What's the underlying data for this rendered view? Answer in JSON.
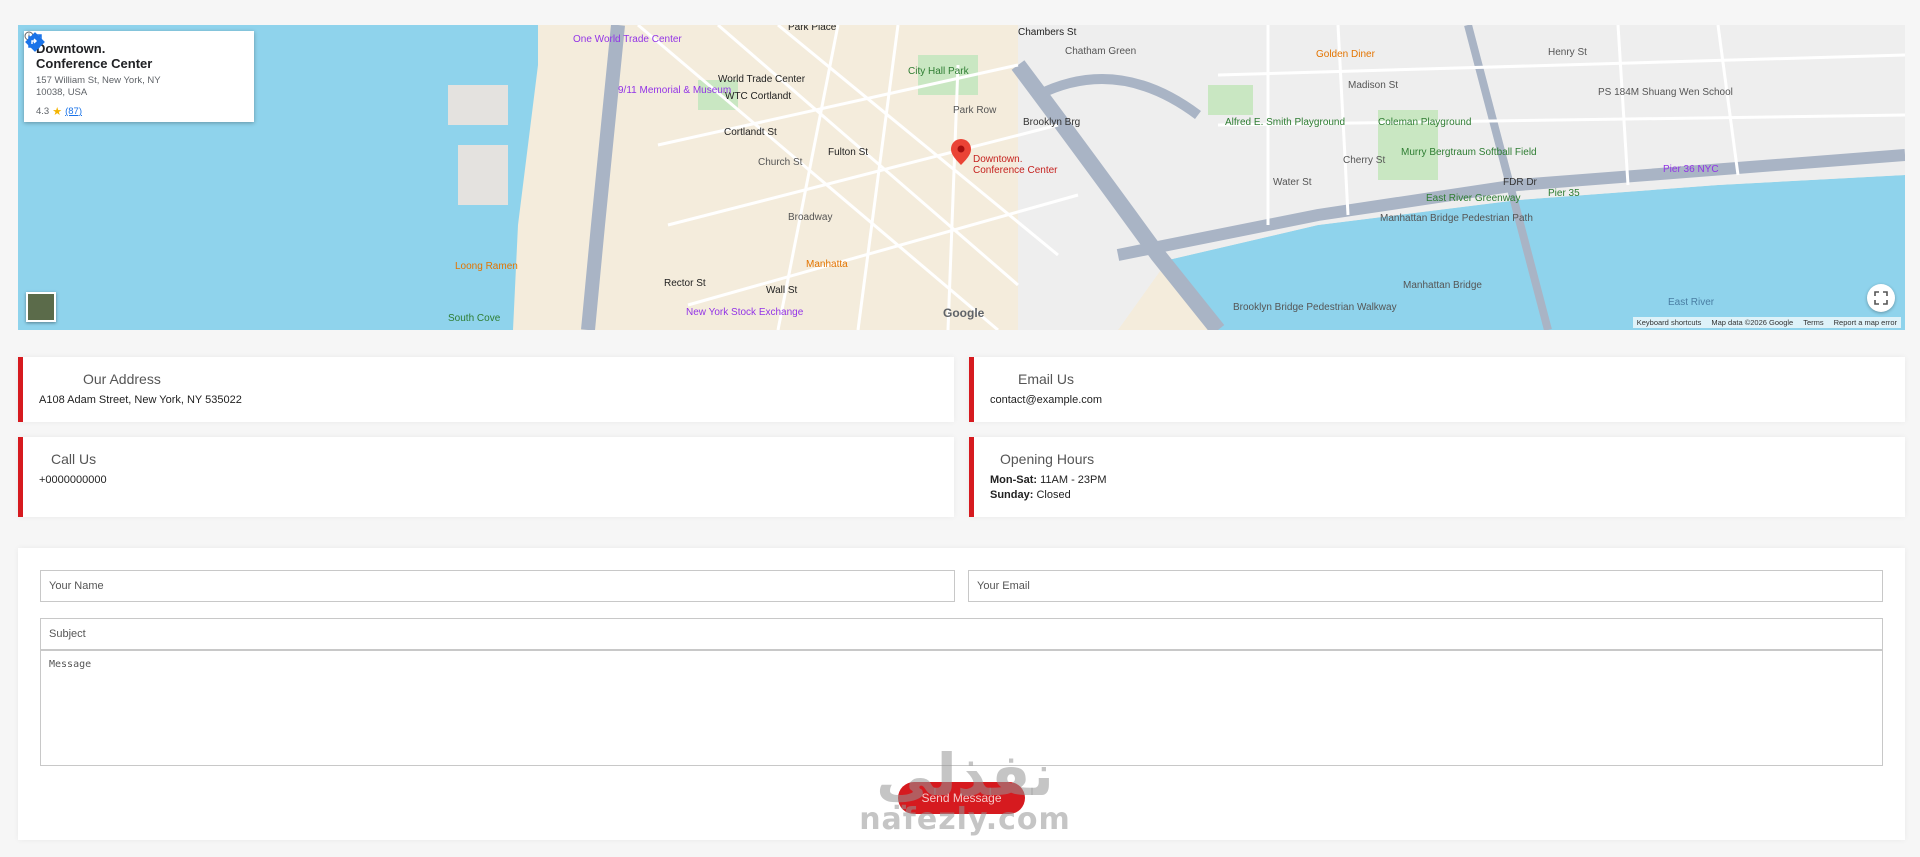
{
  "map": {
    "place_name": "Downtown. Conference Center",
    "place_address": "157 William St, New York, NY 10038, USA",
    "rating": "4.3",
    "rating_count": "(87)",
    "pin_label_line1": "Downtown.",
    "pin_label_line2": "Conference Center",
    "footer": [
      "Keyboard shortcuts",
      "Map data ©2026 Google",
      "Terms",
      "Report a map error"
    ],
    "google": "Google",
    "labels": [
      {
        "text": "One World Trade Center",
        "color": "#9334e6"
      },
      {
        "text": "World Trade Center",
        "color": "#222"
      },
      {
        "text": "WTC Cortlandt",
        "color": "#222"
      },
      {
        "text": "9/11 Memorial & Museum",
        "color": "#9334e6"
      },
      {
        "text": "Cortlandt St",
        "color": "#222"
      },
      {
        "text": "Fulton St",
        "color": "#222"
      },
      {
        "text": "Park Place",
        "color": "#222"
      },
      {
        "text": "Chambers St",
        "color": "#222"
      },
      {
        "text": "City Hall Park",
        "color": "#2e7d32"
      },
      {
        "text": "Chatham Green",
        "color": "#555"
      },
      {
        "text": "Golden Diner",
        "color": "#e37400"
      },
      {
        "text": "Alfred E. Smith Playground",
        "color": "#2e7d32"
      },
      {
        "text": "Coleman Playground",
        "color": "#2e7d32"
      },
      {
        "text": "Murry Bergtraum Softball Field",
        "color": "#2e7d32"
      },
      {
        "text": "PS 184M Shuang Wen School",
        "color": "#555"
      },
      {
        "text": "Pier 36 NYC",
        "color": "#9334e6"
      },
      {
        "text": "East River Greenway",
        "color": "#2e7d32"
      },
      {
        "text": "Pier 35",
        "color": "#2e7d32"
      },
      {
        "text": "Manhattan Bridge Pedestrian Path",
        "color": "#555"
      },
      {
        "text": "Manhattan Bridge",
        "color": "#555"
      },
      {
        "text": "Brooklyn Bridge Pedestrian Walkway",
        "color": "#555"
      },
      {
        "text": "East River",
        "color": "#4a7ea3"
      },
      {
        "text": "Loong Ramen",
        "color": "#e37400"
      },
      {
        "text": "Manhatta",
        "color": "#e37400"
      },
      {
        "text": "South Cove",
        "color": "#2e7d32"
      },
      {
        "text": "Rector St",
        "color": "#222"
      },
      {
        "text": "Wall St",
        "color": "#222"
      },
      {
        "text": "New York Stock Exchange",
        "color": "#9334e6"
      },
      {
        "text": "FDR Dr",
        "color": "#333"
      },
      {
        "text": "Brooklyn Brg",
        "color": "#333"
      },
      {
        "text": "Water St",
        "color": "#555"
      },
      {
        "text": "Cherry St",
        "color": "#555"
      },
      {
        "text": "Madison St",
        "color": "#555"
      },
      {
        "text": "Henry St",
        "color": "#555"
      },
      {
        "text": "Park Row",
        "color": "#555"
      },
      {
        "text": "Broadway",
        "color": "#555"
      },
      {
        "text": "Church St",
        "color": "#555"
      }
    ]
  },
  "contacts": {
    "address_title": "Our Address",
    "address_value": "A108 Adam Street, New York, NY 535022",
    "email_title": "Email Us",
    "email_value": "contact@example.com",
    "call_title": "Call Us",
    "call_value": "+0000000000",
    "hours_title": "Opening Hours",
    "hours_weekday_label": "Mon-Sat:",
    "hours_weekday_value": "11AM - 23PM",
    "hours_sunday_label": "Sunday:",
    "hours_sunday_value": "Closed"
  },
  "form": {
    "name_placeholder": "Your Name",
    "email_placeholder": "Your Email",
    "subject_placeholder": "Subject",
    "message_placeholder": "Message",
    "send_label": "Send Message"
  },
  "watermark": {
    "arabic": "نفذلي",
    "latin": "nafezly.com"
  },
  "colors": {
    "accent": "#d61a1f",
    "water": "#8fd3ec",
    "park": "#c9e7c2"
  }
}
